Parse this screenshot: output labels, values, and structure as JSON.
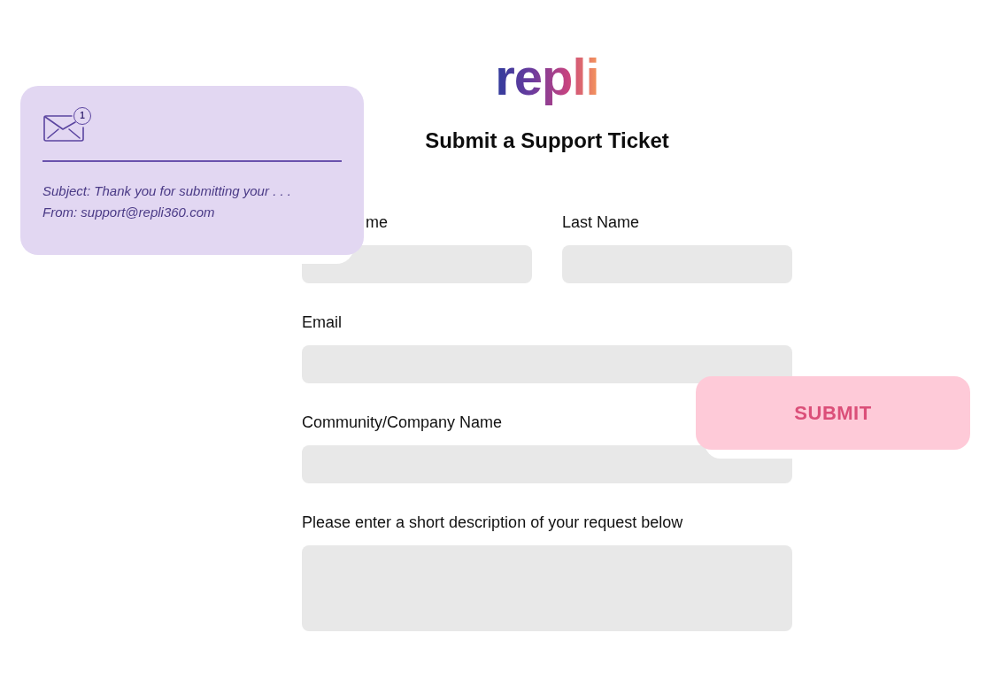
{
  "logo": {
    "text": "repli"
  },
  "title": "Submit a Support Ticket",
  "form": {
    "name_row": [
      {
        "label": "me",
        "kind": "input"
      },
      {
        "label": "Last Name",
        "kind": "input"
      }
    ],
    "fields": [
      {
        "label": "Email",
        "kind": "input"
      },
      {
        "label": "Community/Company Name",
        "kind": "input"
      },
      {
        "label": "Please enter a short description of your request below",
        "kind": "textarea"
      }
    ]
  },
  "email_notification": {
    "badge": "1",
    "subject": "Subject: Thank you for submitting your . . .",
    "from": "From: support@repli360.com"
  },
  "submit_button": {
    "label": "SUBMIT"
  }
}
